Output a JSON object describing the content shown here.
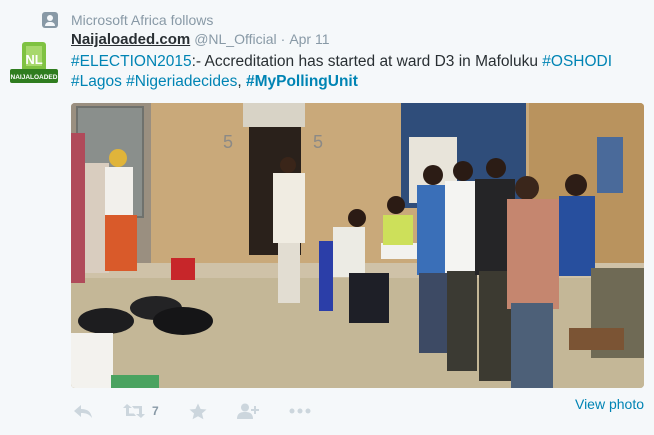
{
  "context": {
    "text": "Microsoft Africa follows",
    "icon": "person-icon"
  },
  "author": {
    "name": "Naijaloaded.com",
    "handle": "@NL_Official",
    "separator": "·",
    "time": "Apr 11",
    "avatar_text": "NL",
    "avatar_subtext": "NAIJALOADED"
  },
  "tweet": {
    "tag1": "#ELECTION2015",
    "text1": ":- Accreditation has started at ward D3 in Mafoluku ",
    "tag2": "#OSHODI",
    "tag3": "#Lagos",
    "text2": " ",
    "tag4": "#Nigeriadecides",
    "text3": ", ",
    "tag5": "#MyPollingUnit"
  },
  "photo": {
    "wall_number_left": "5",
    "wall_number_right": "5"
  },
  "actions": {
    "reply_icon": "reply-icon",
    "retweet_icon": "retweet-icon",
    "retweet_count": "7",
    "favorite_icon": "star-icon",
    "follow_icon": "follow-icon",
    "more_icon": "more-icon",
    "view_photo": "View photo"
  },
  "colors": {
    "link": "#0084b4",
    "muted": "#8899a6",
    "icon": "#ccd6dd",
    "background": "#f5f8fa"
  }
}
